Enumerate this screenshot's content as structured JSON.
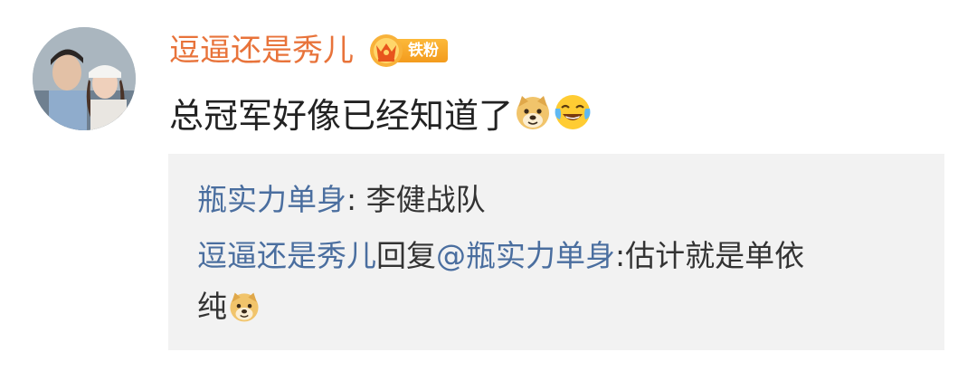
{
  "comment": {
    "username": "逗逼还是秀儿",
    "badge_label": "铁粉",
    "badge_icon": "crown-fan-badge-icon",
    "text": "总冠军好像已经知道了",
    "emojis": [
      "doge-emoji",
      "laugh-cry-emoji"
    ]
  },
  "replies": {
    "reply1": {
      "author": "瓶实力单身",
      "separator": ": ",
      "text": "李健战队"
    },
    "reply2": {
      "author": "逗逼还是秀儿",
      "action": "回复",
      "mention": "@瓶实力单身",
      "separator": ":",
      "text_line1": "估计就是单依",
      "text_line2": "纯",
      "emoji": "doge-emoji"
    }
  },
  "colors": {
    "username": "#e8733a",
    "link": "#4a6e9f",
    "badge": "#f5a623",
    "reply_background": "#f2f2f2",
    "text": "#222222"
  }
}
